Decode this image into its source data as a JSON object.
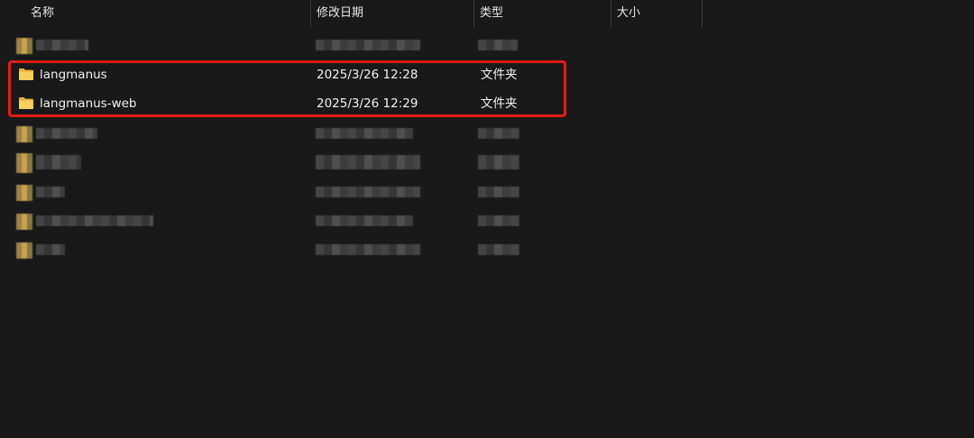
{
  "columns": {
    "name": "名称",
    "modified": "修改日期",
    "type": "类型",
    "size": "大小"
  },
  "sort_indicator": "^",
  "rows": [
    {
      "name": "langmanus",
      "modified": "2025/3/26 12:28",
      "type": "文件夹",
      "icon": "folder-icon"
    },
    {
      "name": "langmanus-web",
      "modified": "2025/3/26 12:29",
      "type": "文件夹",
      "icon": "folder-icon"
    }
  ],
  "colors": {
    "background": "#191919",
    "highlight": "#e21a1a",
    "folder": "#f5c94a"
  }
}
